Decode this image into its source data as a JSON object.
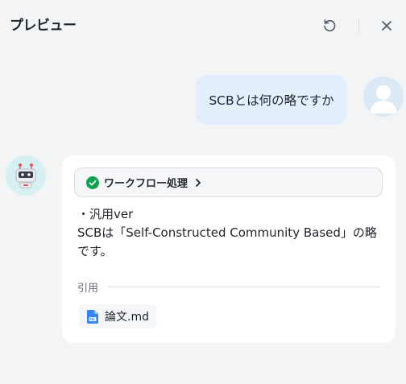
{
  "header": {
    "title": "プレビュー",
    "refresh_icon": "refresh-icon",
    "close_icon": "close-icon"
  },
  "user_message": {
    "text": "SCBとは何の略ですか",
    "avatar_icon": "user-avatar-icon"
  },
  "bot_message": {
    "avatar_icon": "robot-avatar-icon",
    "workflow": {
      "label": "ワークフロー処理",
      "status_icon": "check-circle-icon",
      "status_color": "#12a150"
    },
    "lines": [
      "・汎用ver",
      "SCBは「Self-Constructed Community Based」の略",
      "です。"
    ],
    "citation": {
      "label": "引用",
      "files": [
        {
          "name": "論文.md",
          "icon": "markdown-file-icon",
          "icon_color": "#3b82f6"
        }
      ]
    }
  },
  "colors": {
    "background": "#f3f4f6",
    "user_bubble": "#e3efff",
    "card": "#ffffff",
    "bot_avatar_bg": "#d7f0f1"
  }
}
